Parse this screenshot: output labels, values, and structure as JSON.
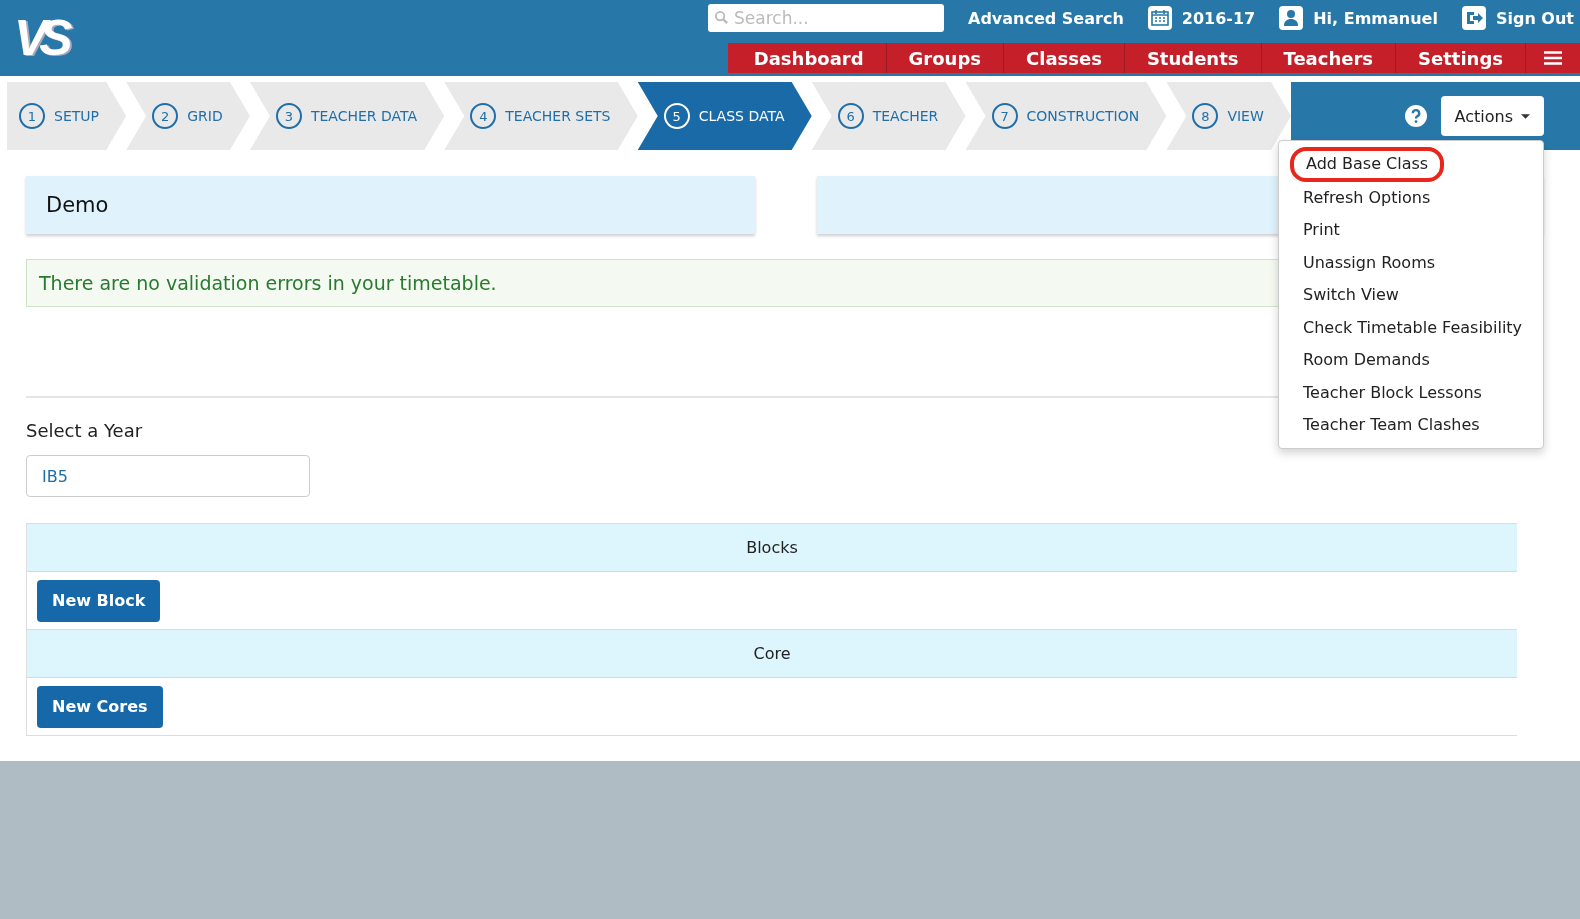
{
  "header": {
    "logo": "VS",
    "search": {
      "placeholder": "Search..."
    },
    "advanced_search": "Advanced Search",
    "year": "2016-17",
    "greeting": "Hi, Emmanuel",
    "sign_out": "Sign Out"
  },
  "nav": [
    {
      "label": "Dashboard"
    },
    {
      "label": "Groups"
    },
    {
      "label": "Classes"
    },
    {
      "label": "Students"
    },
    {
      "label": "Teachers"
    },
    {
      "label": "Settings"
    }
  ],
  "steps": [
    {
      "number": "1",
      "label": "SETUP",
      "selected": false
    },
    {
      "number": "2",
      "label": "GRID",
      "selected": false
    },
    {
      "number": "3",
      "label": "TEACHER DATA",
      "selected": false
    },
    {
      "number": "4",
      "label": "TEACHER SETS",
      "selected": false
    },
    {
      "number": "5",
      "label": "CLASS DATA",
      "selected": true
    },
    {
      "number": "6",
      "label": "TEACHER",
      "selected": false
    },
    {
      "number": "7",
      "label": "CONSTRUCTION",
      "selected": false
    },
    {
      "number": "8",
      "label": "VIEW",
      "selected": false
    }
  ],
  "actions": {
    "label": "Actions",
    "items": [
      {
        "label": "Add Base Class",
        "highlighted": true
      },
      {
        "label": "Refresh Options",
        "highlighted": false
      },
      {
        "label": "Print",
        "highlighted": false
      },
      {
        "label": "Unassign Rooms",
        "highlighted": false
      },
      {
        "label": "Switch View",
        "highlighted": false
      },
      {
        "label": "Check Timetable Feasibility",
        "highlighted": false
      },
      {
        "label": "Room Demands",
        "highlighted": false
      },
      {
        "label": "Teacher Block Lessons",
        "highlighted": false
      },
      {
        "label": "Teacher Team Clashes",
        "highlighted": false
      }
    ]
  },
  "school_name": "Demo",
  "validation_message": "There are no validation errors in your timetable.",
  "year_select": {
    "label": "Select a Year",
    "value": "IB5"
  },
  "sections": [
    {
      "title": "Blocks",
      "button": "New Block"
    },
    {
      "title": "Core",
      "button": "New Cores"
    }
  ]
}
